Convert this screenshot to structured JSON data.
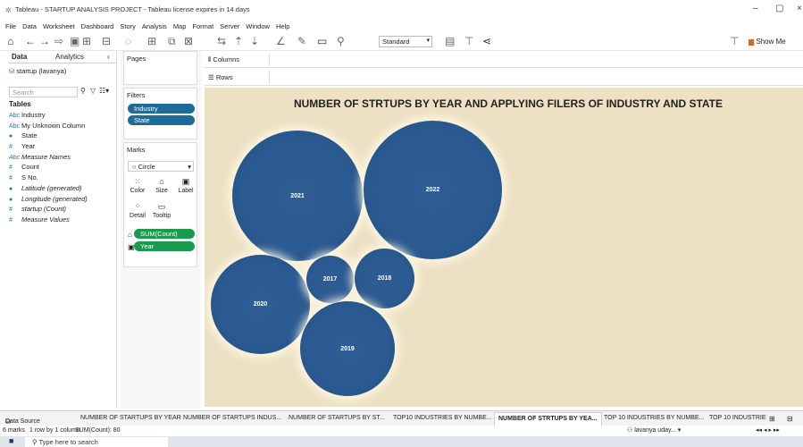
{
  "window": {
    "title": "Tableau - STARTUP ANALYSIS PROJECT - Tableau license expires in 14 days"
  },
  "menu": [
    "File",
    "Data",
    "Worksheet",
    "Dashboard",
    "Story",
    "Analysis",
    "Map",
    "Format",
    "Server",
    "Window",
    "Help"
  ],
  "toolbar": {
    "view_mode": "Standard",
    "show_me": "Show Me"
  },
  "left_panel": {
    "tab_data": "Data",
    "tab_analytics": "Analytics",
    "datasource": "startup (lavanya)",
    "search_placeholder": "Search",
    "tables_header": "Tables",
    "fields": [
      {
        "name": "Industry",
        "type": "Abc",
        "role": "dim",
        "italic": false
      },
      {
        "name": "My Unknown Column",
        "type": "Abc",
        "role": "dim",
        "italic": false
      },
      {
        "name": "State",
        "type": "geo",
        "role": "dim",
        "italic": false
      },
      {
        "name": "Year",
        "type": "#",
        "role": "dim",
        "italic": false
      },
      {
        "name": "Measure Names",
        "type": "Abc",
        "role": "dim",
        "italic": true
      },
      {
        "name": "Count",
        "type": "#",
        "role": "measure",
        "italic": false
      },
      {
        "name": "S No.",
        "type": "#",
        "role": "measure",
        "italic": false
      },
      {
        "name": "Latitude (generated)",
        "type": "geo",
        "role": "measure",
        "italic": true
      },
      {
        "name": "Longitude (generated)",
        "type": "geo",
        "role": "measure",
        "italic": true
      },
      {
        "name": "startup (Count)",
        "type": "#",
        "role": "measure",
        "italic": true
      },
      {
        "name": "Measure Values",
        "type": "#",
        "role": "measure",
        "italic": true
      }
    ]
  },
  "mid_panel": {
    "pages": "Pages",
    "filters": "Filters",
    "filter_pills": [
      "Industry",
      "State"
    ],
    "marks": "Marks",
    "mark_type": "Circle",
    "mark_buttons": [
      "Color",
      "Size",
      "Label",
      "Detail",
      "Tooltip"
    ],
    "mark_pills": [
      "SUM(Count)",
      "Year"
    ]
  },
  "shelves": {
    "columns": "Columns",
    "rows": "Rows"
  },
  "viz": {
    "title": "NUMBER OF STRTUPS BY YEAR AND APPLYING FILERS OF INDUSTRY AND STATE"
  },
  "chart_data": {
    "type": "packed-bubble",
    "title": "NUMBER OF STRTUPS BY YEAR AND APPLYING FILERS OF INDUSTRY AND STATE",
    "size_measure": "SUM(Count)",
    "label": "Year",
    "categories": [
      "2022",
      "2021",
      "2020",
      "2019",
      "2018",
      "2017"
    ],
    "colors": {
      "bubble": "#2a5a91",
      "background": "#ede1c4"
    }
  },
  "sheet_tabs": [
    "Data Source",
    "NUMBER OF STARTUPS BY YEAR",
    "NUMBER OF STARTUPS INDUS...",
    "NUMBER OF STARTUPS BY ST...",
    "TOP10 INDUSTRIES BY NUMBE...",
    "NUMBER OF STRTUPS BY YEA...",
    "TOP 10 INDUSTRIES BY NUMBE...",
    "TOP 10 INDUSTRIE"
  ],
  "status": {
    "marks": "6 marks",
    "rows": "1 row by 1 column",
    "sum": "SUM(Count): 80",
    "user": "lavanya uday..."
  },
  "taskbar": {
    "search": "Type here to search"
  }
}
